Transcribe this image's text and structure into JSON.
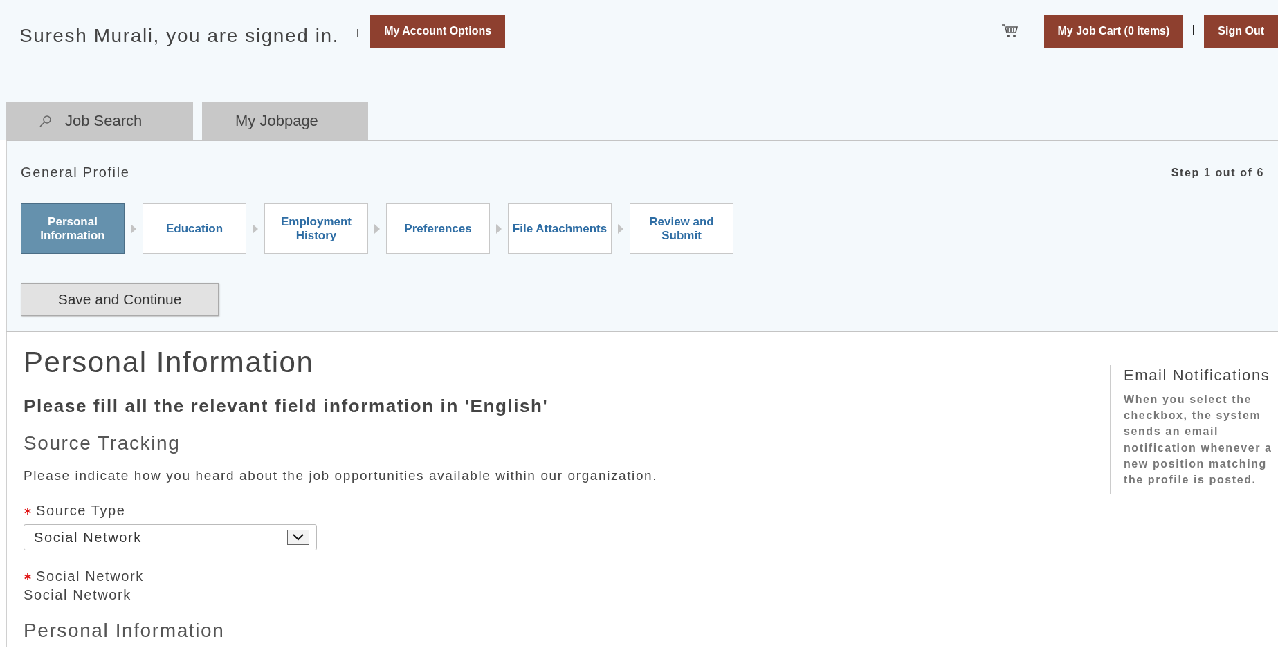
{
  "header": {
    "signed_in": "Suresh Murali, you are signed in.",
    "account_button": "My Account Options",
    "cart_button": "My Job Cart (0 items)",
    "sign_out_button": "Sign Out"
  },
  "tabs": [
    {
      "label": "Job Search"
    },
    {
      "label": "My Jobpage"
    }
  ],
  "profile": {
    "title": "General Profile",
    "step_counter": "Step 1 out of 6",
    "steps": [
      {
        "label": "Personal Information",
        "selected": true
      },
      {
        "label": "Education",
        "selected": false
      },
      {
        "label": "Employment History",
        "selected": false
      },
      {
        "label": "Preferences",
        "selected": false
      },
      {
        "label": "File Attachments",
        "selected": false
      },
      {
        "label": "Review and Submit",
        "selected": false
      }
    ],
    "save_button": "Save and Continue"
  },
  "form": {
    "heading": "Personal Information",
    "instruction": "Please fill all the relevant field information in 'English'",
    "section": "Source Tracking",
    "description": "Please indicate how you heard about the job opportunities available within our organization.",
    "fields": [
      {
        "kind": "select",
        "label": "Source Type",
        "required": true,
        "value": "Social Network"
      },
      {
        "kind": "readonly",
        "label": "Social Network",
        "required": true,
        "value": "Social Network"
      }
    ],
    "next_section": "Personal Information"
  },
  "aside": {
    "title": "Email Notifications",
    "text": "When you select the checkbox, the system sends an email notification whenever a new position matching the profile is posted."
  }
}
